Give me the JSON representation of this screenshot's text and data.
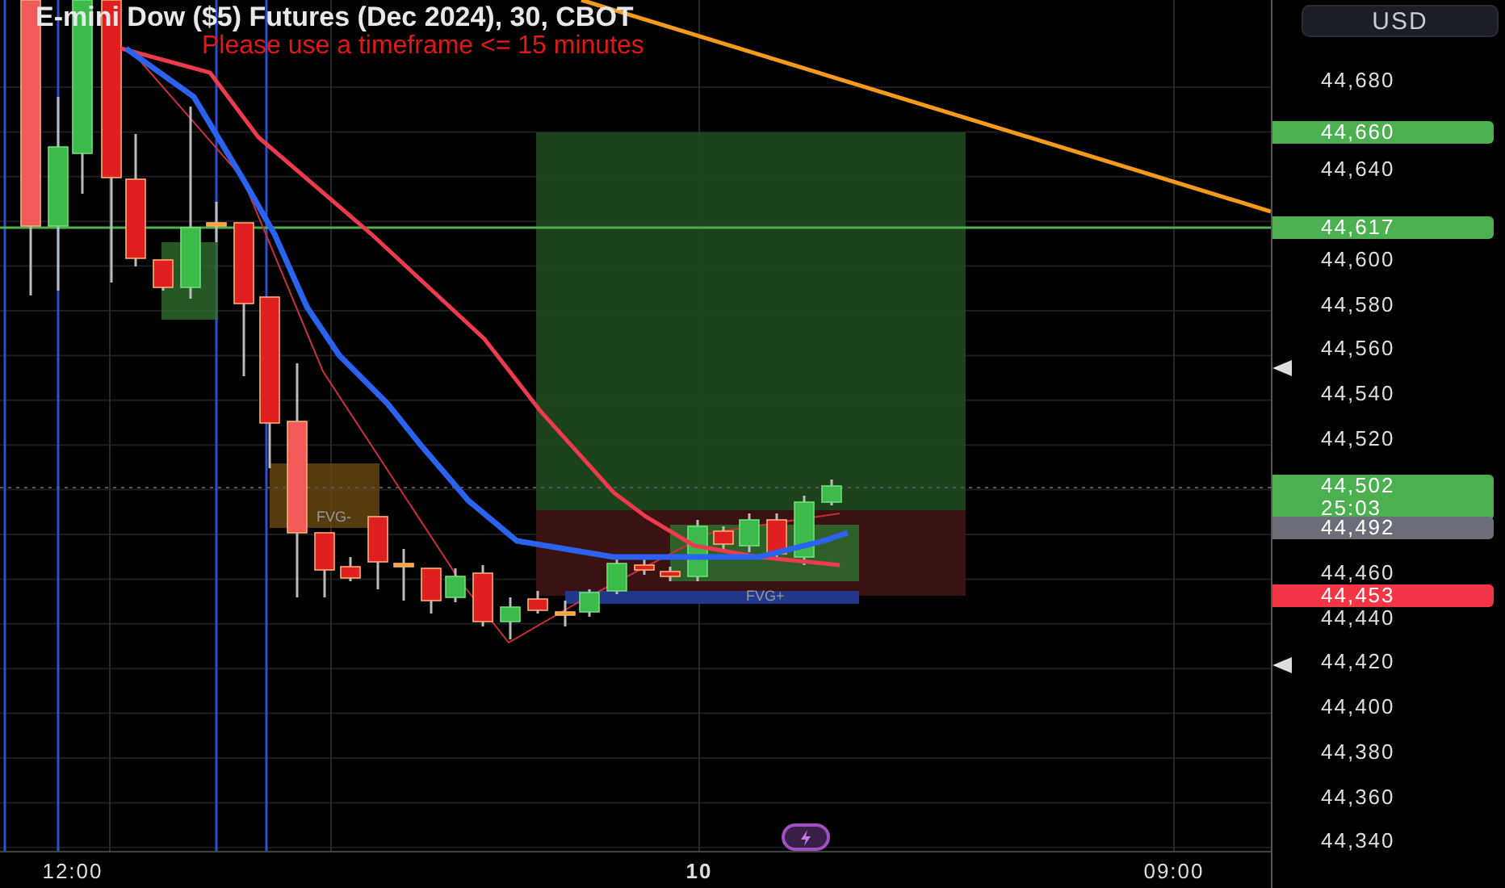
{
  "chart": {
    "title": "E-mini Dow ($5) Futures (Dec 2024), 30, CBOT",
    "notice": "Please use a timeframe <= 15 minutes",
    "zone_labels": [
      {
        "text": "FVG-",
        "kind": "bearish"
      },
      {
        "text": "FVG+",
        "kind": "bullish"
      }
    ]
  },
  "currency_button": "USD",
  "price_axis": [
    "44,680",
    "44,640",
    "44,600",
    "44,580",
    "44,560",
    "44,540",
    "44,520",
    "44,460",
    "44,440",
    "44,420",
    "44,400",
    "44,380",
    "44,360",
    "44,340"
  ],
  "price_tags": [
    {
      "price": "44,660",
      "color": "#4caf50"
    },
    {
      "price": "44,617",
      "color": "#4caf50"
    },
    {
      "price": "44,502",
      "color": "#4caf50",
      "countdown": "25:03"
    },
    {
      "price": "44,492",
      "color": "#6b6e78"
    },
    {
      "price": "44,453",
      "color": "#f23645"
    }
  ],
  "time_axis": [
    {
      "label": "12:00",
      "major": false
    },
    {
      "label": "10",
      "major": true
    },
    {
      "label": "09:00",
      "major": false
    }
  ]
}
